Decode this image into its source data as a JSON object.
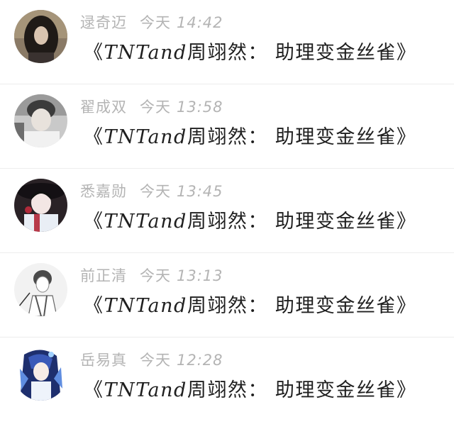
{
  "posts": [
    {
      "author": "逯奇迈",
      "day": "今天",
      "time": "14:42",
      "title_open": "《",
      "title_latin": "TNTand",
      "title_rest": "周翊然：  助理变金丝雀》",
      "avatar_icon": "avatar-portrait-dark-hair"
    },
    {
      "author": "翟成双",
      "day": "今天",
      "time": "13:58",
      "title_open": "《",
      "title_latin": "TNTand",
      "title_rest": "周翊然：  助理变金丝雀》",
      "avatar_icon": "avatar-portrait-grey"
    },
    {
      "author": "悉嘉勋",
      "day": "今天",
      "time": "13:45",
      "title_open": "《",
      "title_latin": "TNTand",
      "title_rest": "周翊然：  助理变金丝雀》",
      "avatar_icon": "avatar-anime-girl-hat"
    },
    {
      "author": "前正清",
      "day": "今天",
      "time": "13:13",
      "title_open": "《",
      "title_latin": "TNTand",
      "title_rest": "周翊然：  助理变金丝雀》",
      "avatar_icon": "avatar-sketch-boy"
    },
    {
      "author": "岳易真",
      "day": "今天",
      "time": "12:28",
      "title_open": "《",
      "title_latin": "TNTand",
      "title_rest": "周翊然：  助理变金丝雀》",
      "avatar_icon": "avatar-anime-blue-hair"
    }
  ]
}
